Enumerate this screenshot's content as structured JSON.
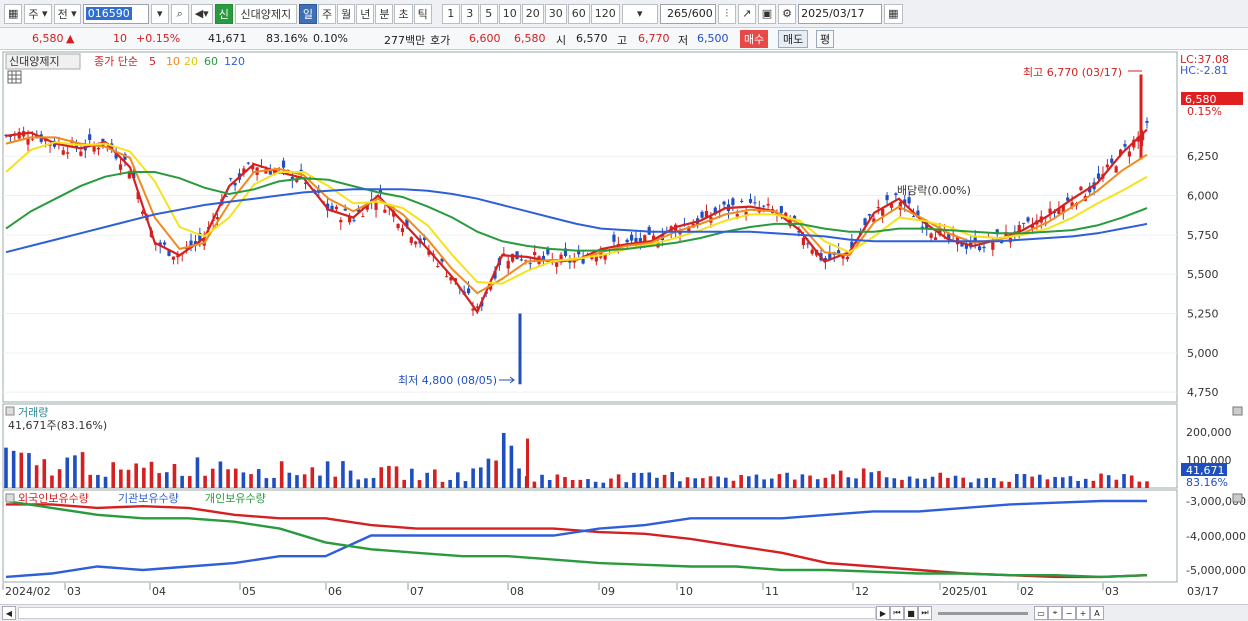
{
  "toolbar": {
    "type_sel": "주",
    "type_sel2": "전",
    "code": "016590",
    "market_badge": "신",
    "stock_name": "신대양제지",
    "periods": [
      "일",
      "주",
      "월",
      "년",
      "분",
      "초",
      "틱"
    ],
    "active_period": "일",
    "intervals": [
      "1",
      "3",
      "5",
      "10",
      "20",
      "30",
      "60",
      "120"
    ],
    "count": "265",
    "count_total": "/600",
    "date": "2025/03/17"
  },
  "quote": {
    "price": "6,580",
    "arrow": "▲",
    "change": "10",
    "change_pct": "+0.15%",
    "volume": "41,671",
    "vol_ratio": "83.16%",
    "turnover": "0.10%",
    "amount": "277백만",
    "ask_label": "호가",
    "ask": "6,600",
    "bid": "6,580",
    "open_label": "시",
    "open": "6,570",
    "high_label": "고",
    "high": "6,770",
    "low_label": "저",
    "low": "6,500",
    "buy": "매수",
    "sell": "매도",
    "avg": "평"
  },
  "legend": {
    "name": "신대양제지",
    "ma_label": "종가 단순",
    "ma_periods": [
      "5",
      "10",
      "20",
      "60",
      "120"
    ],
    "lc": "LC:37.08",
    "hc": "HC:-2.81",
    "high_note": "최고 6,770 (03/17)",
    "low_note": "최저 4,800 (08/05)",
    "dividend_note": "배당락(0.00%)",
    "last_price": "6,580",
    "last_pct": "0.15%"
  },
  "volume_panel": {
    "title": "거래량",
    "current": "41,671주(83.16%)",
    "last": "41,671",
    "last_pct": "83.16%",
    "ticks": [
      "200,000",
      "100,000"
    ]
  },
  "holding_panel": {
    "titles": [
      "외국인보유수량",
      "기관보유수량",
      "개인보유수량"
    ],
    "ticks": [
      "-3,000,000",
      "-4,000,000",
      "-5,000,000"
    ]
  },
  "colors": {
    "up": "#d42020",
    "down": "#1f4fbf",
    "ma5": "#d42020",
    "ma10": "#f08a1e",
    "ma20": "#f5e21a",
    "ma60": "#2a9a3e",
    "ma120": "#2f5fd8"
  },
  "chart_data": {
    "type": "line",
    "price_ticks": [
      "6,250",
      "6,000",
      "5,750",
      "5,500",
      "5,250",
      "5,000",
      "4,750"
    ],
    "ylim": [
      4700,
      6900
    ],
    "x_labels": [
      "2024/02",
      "03",
      "04",
      "05",
      "06",
      "07",
      "08",
      "09",
      "10",
      "11",
      "12",
      "2025/01",
      "02",
      "03",
      "03/17"
    ],
    "series": [
      {
        "name": "5",
        "color": "#d42020",
        "values": [
          6380,
          6400,
          6330,
          6300,
          6340,
          6180,
          5700,
          5620,
          5730,
          6060,
          6200,
          6150,
          6110,
          5910,
          5860,
          6000,
          5830,
          5660,
          5480,
          5260,
          5620,
          5610,
          5580,
          5590,
          5660,
          5690,
          5710,
          5800,
          5840,
          5920,
          5930,
          5900,
          5780,
          5580,
          5640,
          5890,
          5980,
          5830,
          5720,
          5680,
          5720,
          5780,
          5870,
          5980,
          6080,
          6270,
          6420
        ]
      },
      {
        "name": "10",
        "color": "#f08a1e",
        "values": [
          6330,
          6370,
          6370,
          6330,
          6310,
          6240,
          5860,
          5660,
          5700,
          5950,
          6150,
          6170,
          6130,
          5980,
          5900,
          5980,
          5880,
          5720,
          5530,
          5380,
          5470,
          5580,
          5590,
          5590,
          5640,
          5680,
          5700,
          5770,
          5820,
          5880,
          5910,
          5900,
          5820,
          5640,
          5620,
          5830,
          5930,
          5850,
          5760,
          5700,
          5720,
          5760,
          5830,
          5930,
          6030,
          6160,
          6260
        ]
      },
      {
        "name": "20",
        "color": "#f5e21a",
        "values": [
          6150,
          6290,
          6340,
          6320,
          6330,
          6280,
          6090,
          5800,
          5740,
          5860,
          6070,
          6150,
          6150,
          6060,
          5950,
          5960,
          5920,
          5810,
          5620,
          5450,
          5440,
          5520,
          5580,
          5600,
          5620,
          5660,
          5690,
          5730,
          5780,
          5840,
          5880,
          5880,
          5840,
          5710,
          5640,
          5740,
          5860,
          5840,
          5800,
          5740,
          5730,
          5750,
          5790,
          5860,
          5950,
          6030,
          6120
        ]
      },
      {
        "name": "60",
        "color": "#2a9a3e",
        "values": [
          5790,
          5900,
          5980,
          6060,
          6120,
          6150,
          6150,
          6110,
          6050,
          6010,
          6040,
          6090,
          6110,
          6100,
          6060,
          6020,
          5990,
          5930,
          5860,
          5770,
          5710,
          5680,
          5660,
          5650,
          5650,
          5660,
          5680,
          5700,
          5730,
          5770,
          5800,
          5820,
          5820,
          5790,
          5770,
          5770,
          5790,
          5790,
          5780,
          5770,
          5760,
          5760,
          5770,
          5780,
          5810,
          5860,
          5920
        ]
      },
      {
        "name": "120",
        "color": "#2f5fd8",
        "values": [
          5640,
          5680,
          5720,
          5760,
          5800,
          5840,
          5880,
          5910,
          5940,
          5960,
          5980,
          6000,
          6020,
          6030,
          6040,
          6040,
          6040,
          6030,
          6010,
          5980,
          5940,
          5900,
          5860,
          5820,
          5790,
          5780,
          5770,
          5770,
          5770,
          5770,
          5770,
          5760,
          5750,
          5740,
          5720,
          5710,
          5710,
          5710,
          5710,
          5710,
          5710,
          5720,
          5730,
          5740,
          5760,
          5790,
          5820
        ]
      }
    ],
    "volume_values": [
      120000,
      95000,
      80000,
      110000,
      70000,
      60000,
      85000,
      75000,
      90000,
      95000,
      80000,
      70000,
      65000,
      85000,
      60000,
      55000,
      60000,
      50000,
      45000,
      55000,
      185000,
      45000,
      40000,
      35000,
      40000,
      38000,
      42000,
      45000,
      50000,
      48000,
      40000,
      38000,
      52000,
      60000,
      65000,
      45000,
      40000,
      42000,
      38000,
      35000,
      40000,
      36000,
      38000,
      40000,
      45000,
      50000,
      41671
    ],
    "holdings": [
      {
        "name": "외국인보유수량",
        "color": "#d42020",
        "values": [
          -3100000,
          -3100000,
          -3200000,
          -3150000,
          -3200000,
          -3400000,
          -3500000,
          -3500000,
          -3700000,
          -3800000,
          -3800000,
          -3800000,
          -3800000,
          -3900000,
          -3950000,
          -4100000,
          -4300000,
          -4500000,
          -4800000,
          -4900000,
          -5000000,
          -5100000,
          -5150000,
          -5200000,
          -5200000,
          -5150000
        ]
      },
      {
        "name": "기관보유수량",
        "color": "#2f5fd8",
        "values": [
          -5200000,
          -5100000,
          -4900000,
          -5000000,
          -4900000,
          -4800000,
          -4600000,
          -4600000,
          -4000000,
          -4000000,
          -4000000,
          -4000000,
          -4000000,
          -3800000,
          -3700000,
          -3500000,
          -3500000,
          -3500000,
          -3400000,
          -3300000,
          -3300000,
          -3200000,
          -3100000,
          -3050000,
          -3000000,
          -3000000
        ]
      },
      {
        "name": "개인보유수량",
        "color": "#2a9a3e",
        "values": [
          -3000000,
          -3200000,
          -3400000,
          -3500000,
          -3500000,
          -3600000,
          -3800000,
          -4200000,
          -4400000,
          -4500000,
          -4600000,
          -4600000,
          -4700000,
          -4800000,
          -4850000,
          -4900000,
          -4900000,
          -5000000,
          -5000000,
          -5050000,
          -5100000,
          -5100000,
          -5150000,
          -5150000,
          -5200000,
          -5150000
        ]
      }
    ]
  }
}
